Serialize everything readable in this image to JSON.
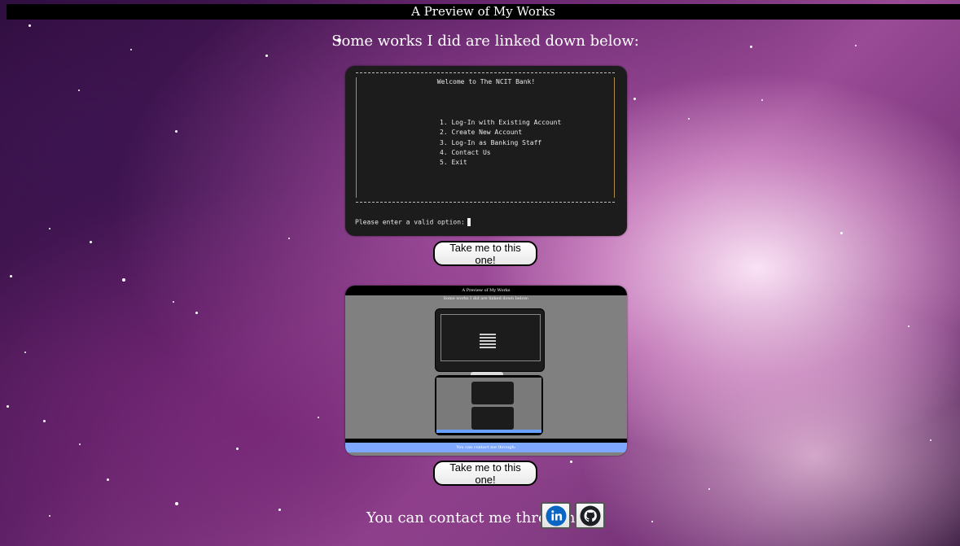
{
  "header": {
    "title": "A Preview of My Works"
  },
  "intro": {
    "text": "Some works I did are linked down below:"
  },
  "projects": [
    {
      "preview": {
        "heading": "Welcome to The NCIT Bank!",
        "menu": [
          "1. Log-In with Existing Account",
          "2. Create New Account",
          "3. Log-In as Banking Staff",
          "4. Contact Us",
          "5. Exit"
        ],
        "prompt": "Please enter a valid option:"
      },
      "button_label": "Take me to this one!"
    },
    {
      "preview": {
        "title": "A Preview of My Works",
        "subtitle": "Some works I did are linked down below:",
        "contact": "You can contact me through:"
      },
      "button_label": "Take me to this one!"
    }
  ],
  "contact": {
    "text": "You can contact me through:",
    "links": [
      {
        "icon": "linkedin-icon",
        "color": "#0a66c2"
      },
      {
        "icon": "github-icon",
        "color": "#1b1f23"
      }
    ]
  }
}
